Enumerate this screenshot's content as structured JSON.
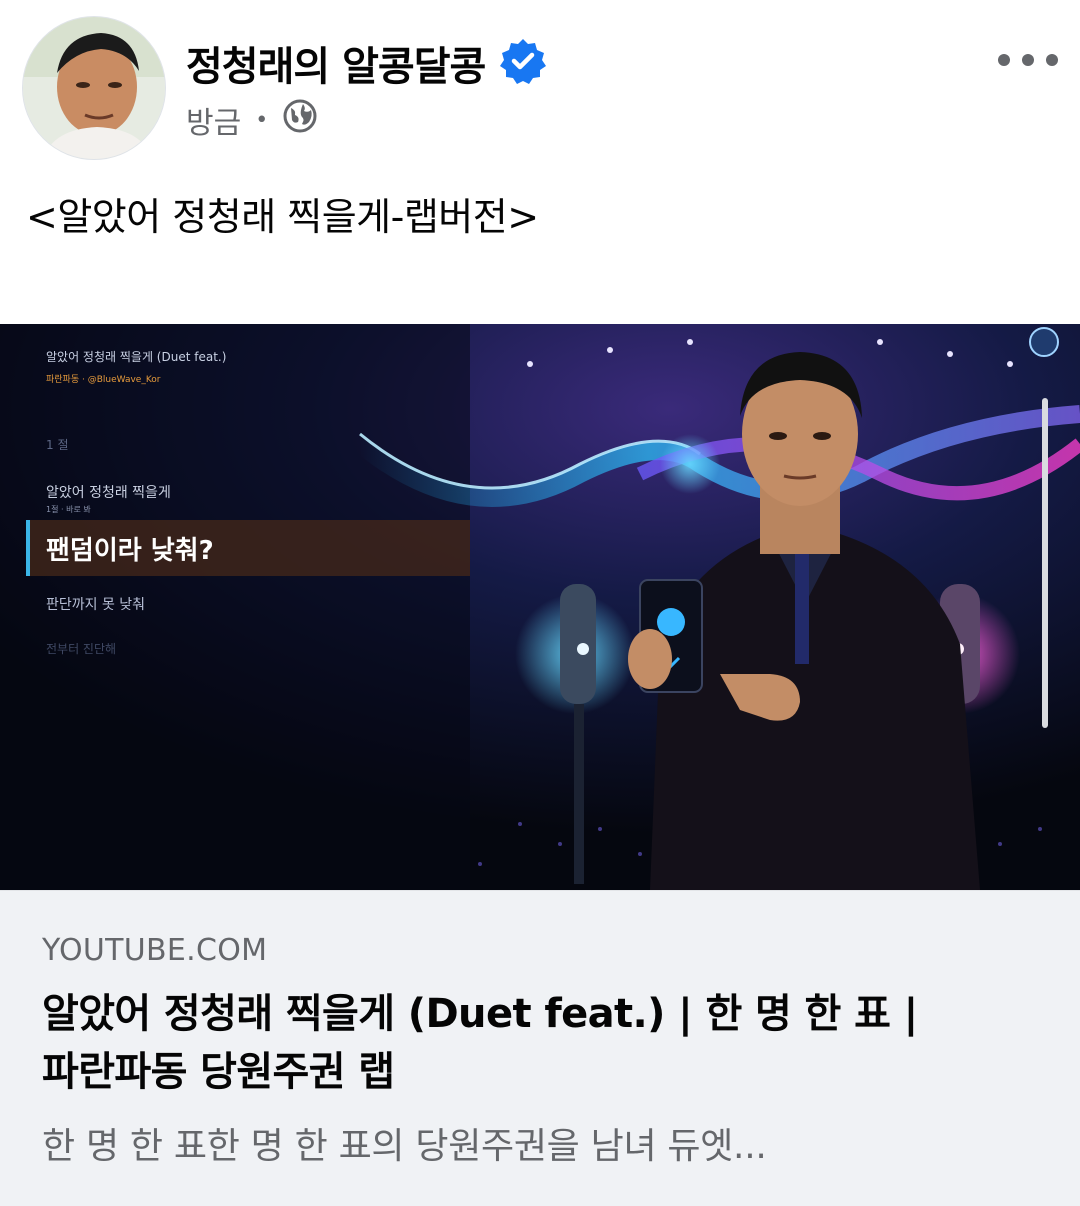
{
  "post": {
    "author": "정청래의 알콩달콩",
    "verified_icon": "verified-badge-icon",
    "timestamp": "방금",
    "separator": "•",
    "audience_icon": "globe-icon",
    "more_icon": "more-options-icon",
    "text": "<알았어 정청래 찍을게-랩버전>"
  },
  "video_overlay": {
    "title": "알았어 정청래 찍을게 (Duet feat.)",
    "subtitle": "파란파동 · @BlueWave_Kor",
    "section": "1 절",
    "line1": "알았어 정청래 찍을게",
    "line1_sub": "1절 · 바로 봐",
    "active_line": "팬덤이라 낮춰?",
    "line3": "판단까지 못 낮춰",
    "line4": "전부터 진단해"
  },
  "link": {
    "domain": "YOUTUBE.COM",
    "title_line1": "알았어 정청래 찍을게 (Duet feat.) | 한 명 한 표 |",
    "title_line2": "파란파동 당원주권 랩",
    "description": "한 명 한 표한 명 한 표의 당원주권을 남녀 듀엣..."
  },
  "colors": {
    "verified": "#1877f2",
    "secondary_text": "#65676b",
    "card_bg": "#f0f2f5",
    "overlay_highlight": "#3bb6e8"
  }
}
